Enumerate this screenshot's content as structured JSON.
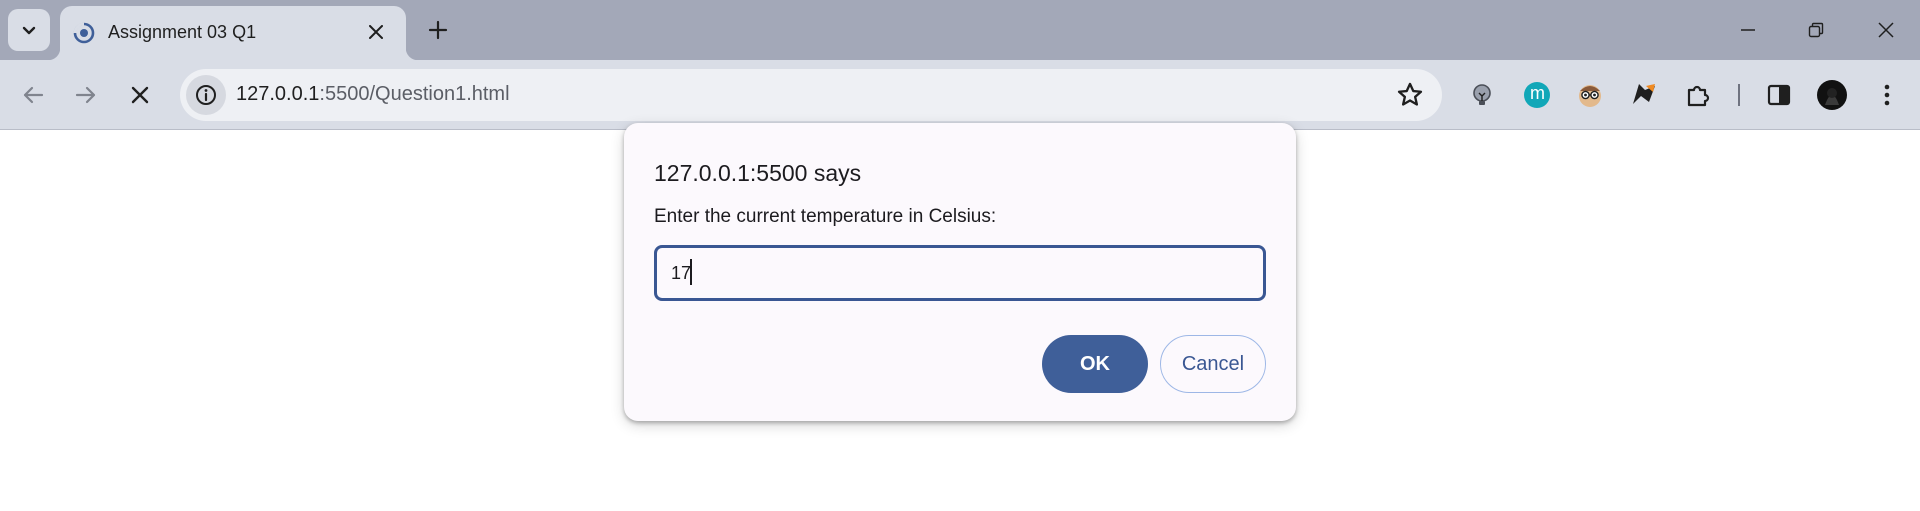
{
  "tab": {
    "title": "Assignment 03 Q1"
  },
  "address_bar": {
    "host": "127.0.0.1",
    "path": ":5500/Question1.html"
  },
  "extensions": [
    "lightbulb-extension",
    "m-extension",
    "glasses-face-extension",
    "feather-extension",
    "puzzle-extensions",
    "side-panel",
    "profile-avatar",
    "more-menu"
  ],
  "extension_m_label": "m",
  "dialog": {
    "title": "127.0.0.1:5500 says",
    "message": "Enter the current temperature in Celsius:",
    "input_value": "17",
    "ok_label": "OK",
    "cancel_label": "Cancel"
  },
  "colors": {
    "accent": "#3f5f99",
    "tabstrip": "#a3a8b8",
    "toolbar": "#d9dde6",
    "dialog_bg": "#fcf9fd"
  }
}
